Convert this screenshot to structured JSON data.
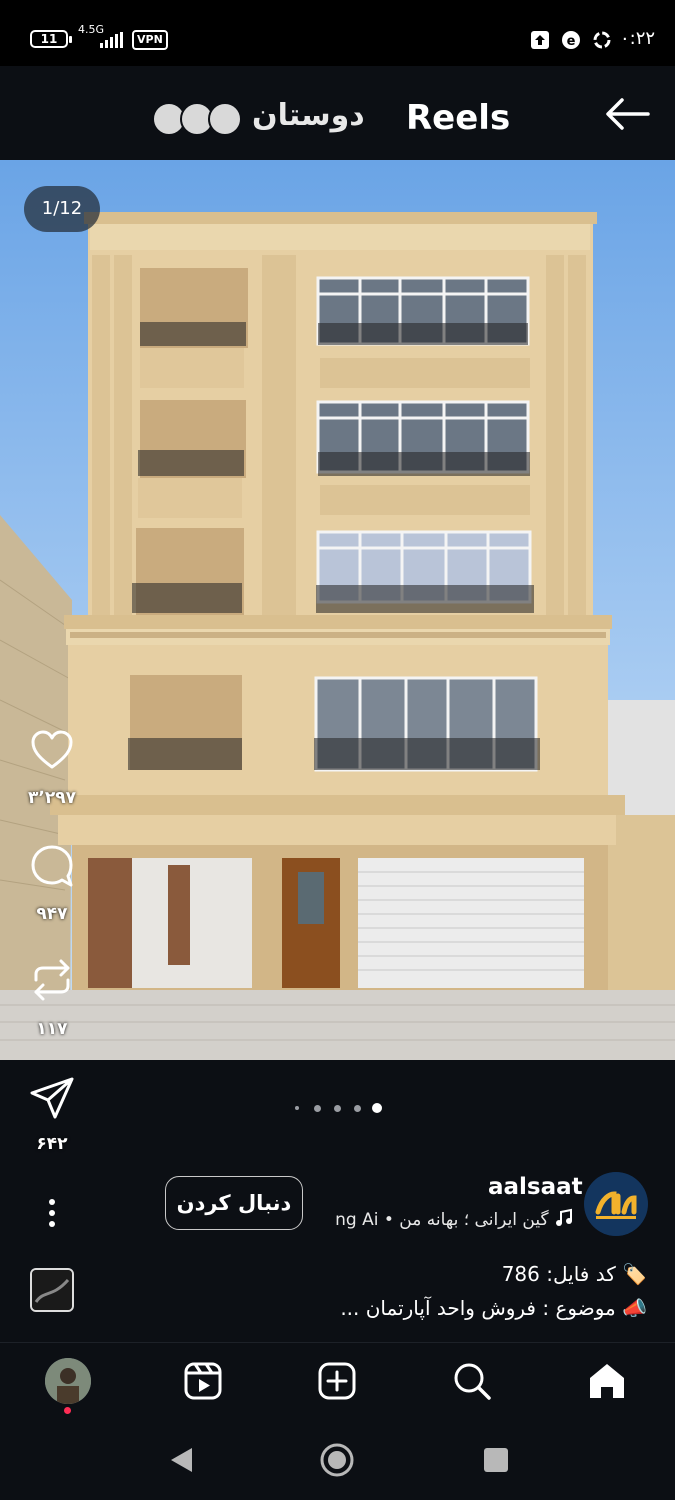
{
  "status_bar": {
    "battery": "11",
    "network": "4.5G",
    "vpn": "VPN",
    "time": "۰:۲۲"
  },
  "header": {
    "title": "Reels",
    "friends_label": "دوستان",
    "back_icon": "arrow-left-icon"
  },
  "media": {
    "counter": "1/12",
    "pager": {
      "count": 5,
      "active_index": 4
    }
  },
  "actions": {
    "likes": "۳٬۲۹۷",
    "comments": "۹۴۷",
    "reposts": "۱۱۷",
    "shares": "۶۴۲"
  },
  "profile": {
    "username": "aalsaat",
    "follow_label": "دنبال کردن",
    "music_text": "گین ایرانی ؛ بهانه من • ng Ai"
  },
  "caption": {
    "line1": "🏷️ کد فایل: 786",
    "line2": "📣 موضوع : فروش واحد آپارتمان ..."
  },
  "bottom_nav": {
    "items": [
      "home-icon",
      "search-icon",
      "create-icon",
      "reels-icon",
      "profile-avatar"
    ]
  },
  "colors": {
    "background": "#0c0f14",
    "facade": "#e6cfa3",
    "sky": "#6aa4e6",
    "notification": "#ff2d55"
  }
}
